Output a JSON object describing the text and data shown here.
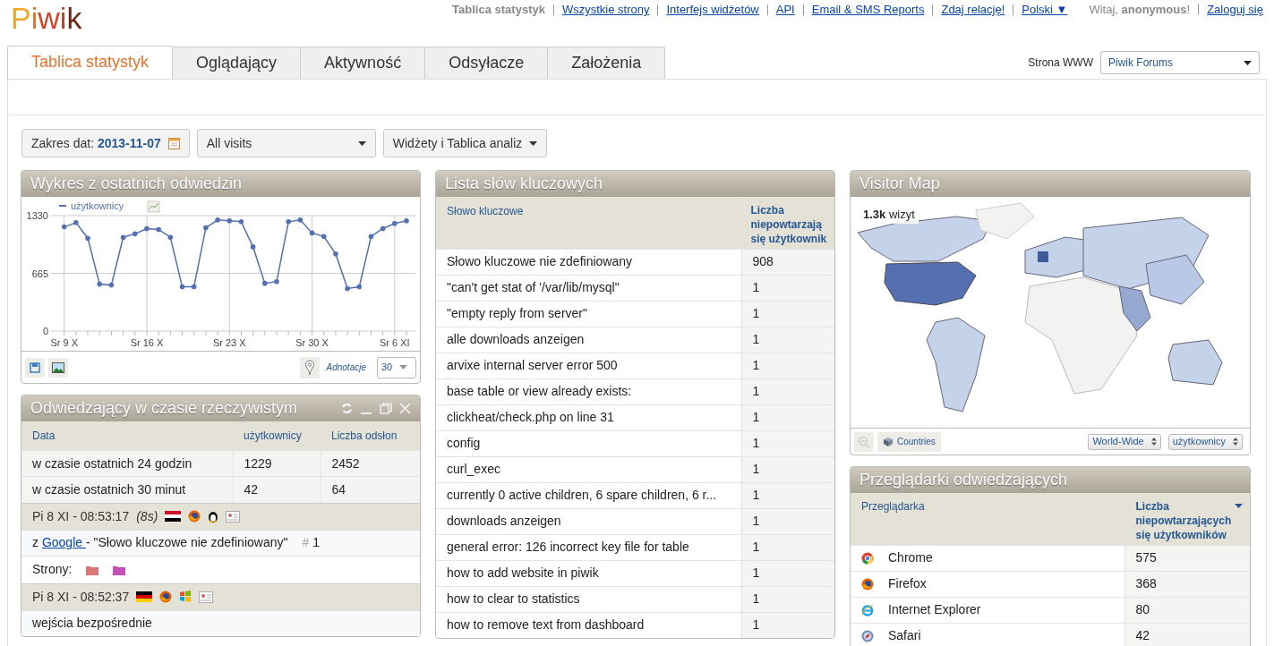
{
  "logo": "Piwik",
  "top_nav": [
    {
      "label": "Tablica statystyk",
      "selected": true
    },
    {
      "label": "Wszystkie strony",
      "selected": false
    },
    {
      "label": "Interfejs widżetów",
      "selected": false
    },
    {
      "label": "API",
      "selected": false
    },
    {
      "label": "Email & SMS Reports",
      "selected": false
    },
    {
      "label": "Zdaj relację!",
      "selected": false
    },
    {
      "label": "Polski ▼",
      "selected": false
    }
  ],
  "greeting": "Witaj, **anonymous**!",
  "login": "Zaloguj się",
  "tabs": [
    {
      "label": "Tablica statystyk",
      "selected": true
    },
    {
      "label": "Oglądający",
      "selected": false
    },
    {
      "label": "Aktywność",
      "selected": false
    },
    {
      "label": "Odsyłacze",
      "selected": false
    },
    {
      "label": "Założenia",
      "selected": false
    }
  ],
  "site_selector": {
    "label": "Strona WWW",
    "value": "Piwik Forums"
  },
  "date_range": {
    "label": "Zakres dat:",
    "value": "2013-11-07"
  },
  "segment": "All visits",
  "dashboard_menu": "Widżety i Tablica analiz",
  "visits_chart": {
    "title": "Wykres z ostatnich odwiedzin",
    "annotations_label": "Adnotacje",
    "period": "30",
    "chart_data": {
      "type": "line",
      "categories": [
        "Sr 9 X",
        null,
        null,
        null,
        null,
        null,
        null,
        "Sr 16 X",
        null,
        null,
        null,
        null,
        null,
        null,
        "Sr 23 X",
        null,
        null,
        null,
        null,
        null,
        null,
        "Sr 30 X",
        null,
        null,
        null,
        null,
        null,
        null,
        "Sr 6 XI",
        null
      ],
      "series": [
        {
          "name": "użytkownicy",
          "color": "#5470b0",
          "values": [
            1200,
            1250,
            1070,
            540,
            530,
            1080,
            1120,
            1180,
            1170,
            1080,
            510,
            510,
            1190,
            1280,
            1270,
            1260,
            970,
            550,
            570,
            1260,
            1280,
            1130,
            1090,
            890,
            490,
            510,
            1090,
            1180,
            1240,
            1270
          ]
        }
      ],
      "ylim": [
        0,
        1330
      ],
      "yticks": [
        0,
        665,
        1330
      ],
      "grid": true
    }
  },
  "realtime": {
    "title": "Odwiedzający w czasie rzeczywistym",
    "columns": [
      "Data",
      "użytkownicy",
      "Liczba odsłon"
    ],
    "rows": [
      [
        "w czasie ostatnich 24 godzin",
        "1229",
        "2452"
      ],
      [
        "w czasie ostatnich 30 minut",
        "42",
        "64"
      ]
    ],
    "visits": [
      {
        "time": "Pi 8 XI - 08:53:17",
        "duration": "(8s)",
        "icons": [
          {
            "kind": "flag-eg"
          },
          {
            "kind": "firefox"
          },
          {
            "kind": "linux"
          },
          {
            "kind": "card"
          }
        ],
        "referrer": {
          "prefix": "z",
          "link": "Google",
          "rest": "- \"Słowo kluczowe nie zdefiniowany\"",
          "hash": "#",
          "rank": "1"
        },
        "pages_label": "Strony:",
        "pages": [
          {
            "color": "#d9767a"
          },
          {
            "color": "#c44fb8"
          }
        ]
      },
      {
        "time": "Pi 8 XI - 08:52:37",
        "icons": [
          {
            "kind": "flag-de"
          },
          {
            "kind": "firefox"
          },
          {
            "kind": "windows"
          },
          {
            "kind": "card"
          }
        ],
        "referrer_text": "wejścia bezpośrednie"
      }
    ]
  },
  "keywords": {
    "title": "Lista słów kluczowych",
    "columns": [
      "Słowo kluczowe",
      "Liczba niepowtarzają się użytkownik"
    ],
    "rows": [
      [
        "Słowo kluczowe nie zdefiniowany",
        "908"
      ],
      [
        "\"can't get stat of '/var/lib/mysql\"",
        "1"
      ],
      [
        "\"empty reply from server\"",
        "1"
      ],
      [
        "alle downloads anzeigen",
        "1"
      ],
      [
        "arvixe internal server error 500",
        "1"
      ],
      [
        "base table or view already exists:",
        "1"
      ],
      [
        "clickheat/check.php on line 31",
        "1"
      ],
      [
        "config",
        "1"
      ],
      [
        "curl_exec",
        "1"
      ],
      [
        "currently 0 active children, 6 spare children, 6 r...",
        "1"
      ],
      [
        "downloads anzeigen",
        "1"
      ],
      [
        "general error: 126 incorrect key file for table",
        "1"
      ],
      [
        "how to add website in piwik",
        "1"
      ],
      [
        "how to clear to statistics",
        "1"
      ],
      [
        "how to remove text from dashboard",
        "1"
      ]
    ]
  },
  "visitor_map": {
    "title": "Visitor Map",
    "total": "**1.3k** wizyt",
    "mode": "Countries",
    "region": "World-Wide",
    "metric": "użytkownicy"
  },
  "browsers": {
    "title": "Przeglądarki odwiedzających",
    "columns": [
      "Przeglądarka",
      "Liczba niepowtarzających się użytkowników"
    ],
    "rows": [
      {
        "kind": "chrome",
        "name": "Chrome",
        "value": "575"
      },
      {
        "kind": "firefox",
        "name": "Firefox",
        "value": "368"
      },
      {
        "kind": "ie",
        "name": "Internet Explorer",
        "value": "80"
      },
      {
        "kind": "safari",
        "name": "Safari",
        "value": "42"
      }
    ]
  }
}
